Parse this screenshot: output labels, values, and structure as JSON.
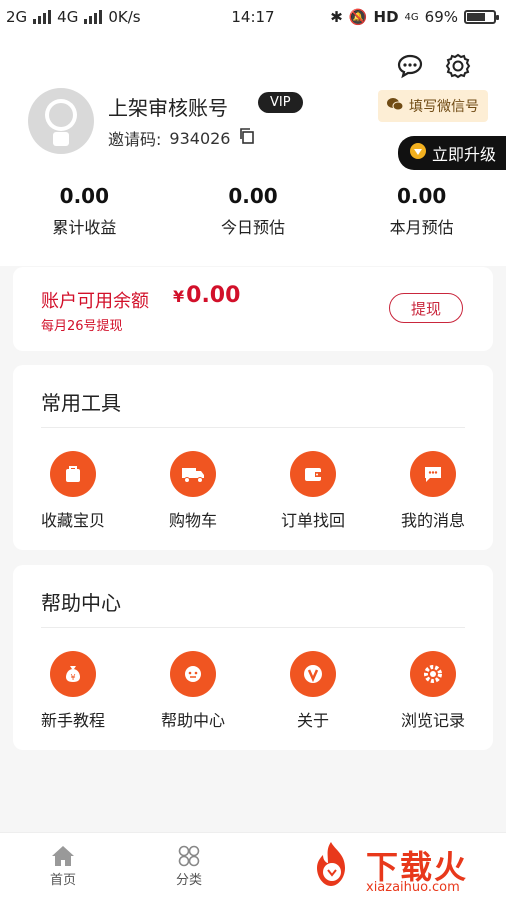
{
  "status": {
    "net1": "2G",
    "net2": "4G",
    "speed": "0K/s",
    "time": "14:17",
    "hd": "HD",
    "lte": "4G",
    "battery_pct": "69%",
    "battery_level": 0.69
  },
  "header": {
    "username": "上架审核账号",
    "vip": "VIP",
    "invite_label": "邀请码:",
    "invite_code": "934026",
    "wechat_tag": "填写微信号",
    "upgrade": "立即升级"
  },
  "stats": [
    {
      "value": "0.00",
      "label": "累计收益"
    },
    {
      "value": "0.00",
      "label": "今日预估"
    },
    {
      "value": "0.00",
      "label": "本月预估"
    }
  ],
  "balance": {
    "label": "账户可用余额",
    "currency": "¥",
    "amount": "0.00",
    "note": "每月26号提现",
    "withdraw": "提现"
  },
  "tools": {
    "title": "常用工具",
    "items": [
      {
        "label": "收藏宝贝",
        "icon": "bag-icon"
      },
      {
        "label": "购物车",
        "icon": "truck-icon"
      },
      {
        "label": "订单找回",
        "icon": "wallet-icon"
      },
      {
        "label": "我的消息",
        "icon": "message-icon"
      }
    ]
  },
  "help": {
    "title": "帮助中心",
    "items": [
      {
        "label": "新手教程",
        "icon": "money-bag-icon"
      },
      {
        "label": "帮助中心",
        "icon": "support-icon"
      },
      {
        "label": "关于",
        "icon": "v-icon"
      },
      {
        "label": "浏览记录",
        "icon": "gear-icon"
      }
    ]
  },
  "tabbar": {
    "items": [
      {
        "label": "首页"
      },
      {
        "label": "分类"
      }
    ]
  },
  "watermark": {
    "text": "下载火",
    "url": "xiazaihuo.com"
  },
  "colors": {
    "accent": "#f05521",
    "balance_red": "#d2102a",
    "vip_bg": "#202020"
  }
}
